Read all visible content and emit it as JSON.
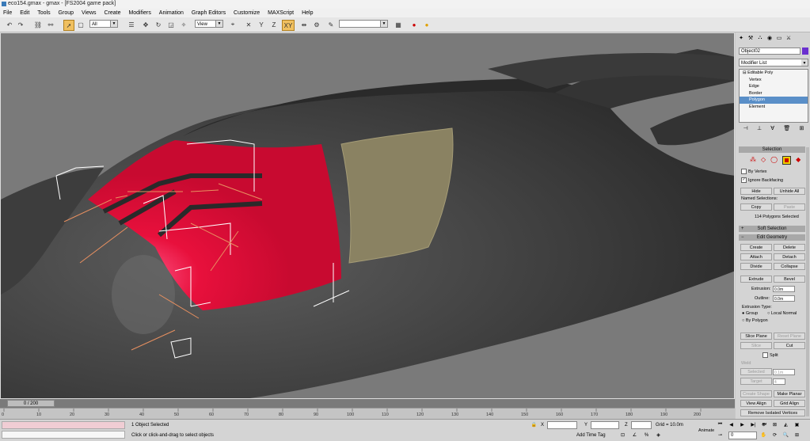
{
  "window": {
    "title": "eco154.gmax - gmax - [FS2004 game pack]"
  },
  "menu": [
    "File",
    "Edit",
    "Tools",
    "Group",
    "Views",
    "Create",
    "Modifiers",
    "Animation",
    "Graph Editors",
    "Customize",
    "MAXScript",
    "Help"
  ],
  "toolbar": {
    "selection_filter": "All",
    "ref_coord": "View",
    "named_selection": ""
  },
  "command_panel": {
    "object_name": "Object02",
    "object_color": "#6a2fcf",
    "modifier_list": "Modifier List",
    "stack": [
      "Editable Poly",
      "Vertex",
      "Edge",
      "Border",
      "Polygon",
      "Element"
    ],
    "selected_stack_item": "Polygon",
    "selection": {
      "title": "Selection",
      "by_vertex": "By Vertex",
      "ignore_backfacing": "Ignore Backfacing",
      "hide": "Hide",
      "unhide_all": "Unhide All",
      "named_selections": "Named Selections:",
      "copy": "Copy",
      "paste": "Paste",
      "status": "114 Polygons Selected"
    },
    "soft_selection": "Soft Selection",
    "edit_geometry": {
      "title": "Edit Geometry",
      "create": "Create",
      "delete": "Delete",
      "attach": "Attach",
      "detach": "Detach",
      "divide": "Divide",
      "collapse": "Collapse",
      "extrude": "Extrude",
      "bevel": "Bevel",
      "extrusion_label": "Extrusion:",
      "extrusion_value": "0.0m",
      "outline_label": "Outline:",
      "outline_value": "0.0m",
      "extrusion_type": "Extrusion Type:",
      "group": "Group",
      "local_normal": "Local Normal",
      "by_polygon": "By Polygon",
      "slice_plane": "Slice Plane",
      "reset_plane": "Reset Plane",
      "slice": "Slice",
      "cut": "Cut",
      "split": "Split",
      "weld_label": "Weld",
      "selected": "Selected",
      "weld_value": "0.1m",
      "target": "Target",
      "target_value": "4",
      "create_shape": "Create Shape",
      "make_planar": "Make Planar",
      "view_align": "View Align",
      "grid_align": "Grid Align",
      "remove_isolated": "Remove Isolated Vertices"
    }
  },
  "timeline": {
    "slider": "0 / 200",
    "ticks": [
      "0",
      "10",
      "20",
      "30",
      "40",
      "50",
      "60",
      "70",
      "80",
      "90",
      "100",
      "110",
      "120",
      "130",
      "140",
      "150",
      "160",
      "170",
      "180",
      "190",
      "200"
    ]
  },
  "status": {
    "selected": "1 Object Selected",
    "prompt": "Click or click-and-drag to select objects",
    "x_label": "X",
    "y_label": "Y",
    "z_label": "Z",
    "grid": "Grid = 10.0m",
    "add_time_tag": "Add Time Tag",
    "animate": "Animate",
    "frame": "0"
  }
}
